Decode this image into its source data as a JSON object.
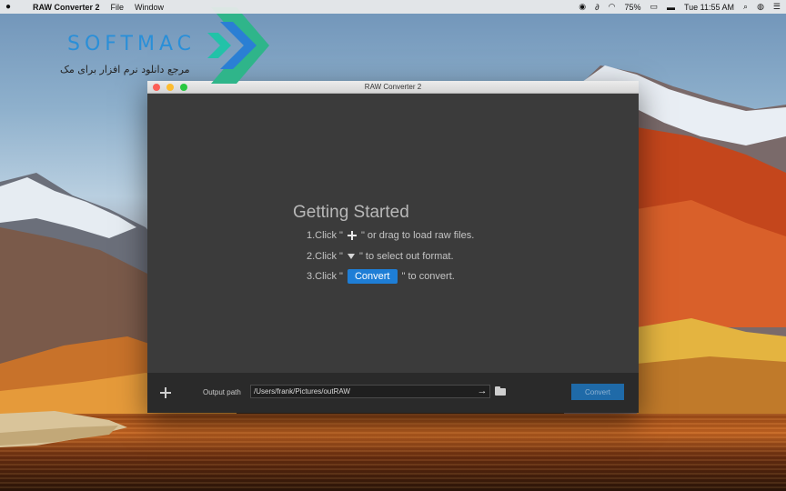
{
  "menubar": {
    "apple_icon": "apple-icon",
    "app_name": "RAW Converter 2",
    "menus": [
      "File",
      "Window"
    ],
    "battery": "75%",
    "clock": "Tue 11:55 AM"
  },
  "watermark": {
    "brand": "SOFTMAC",
    "tagline": "مرجع دانلود نرم افزار برای مک"
  },
  "window": {
    "title": "RAW Converter 2",
    "getting_started": {
      "title": "Getting Started",
      "step1_prefix": "1.Click \"",
      "step1_suffix": "\" or drag to load raw files.",
      "step2_prefix": "2.Click \"",
      "step2_suffix": "\" to select out format.",
      "step3_prefix": "3.Click \"",
      "step3_button": "Convert",
      "step3_suffix": "\" to convert."
    },
    "bottom": {
      "output_label": "Output path",
      "output_path": "/Users/frank/Pictures/outRAW",
      "convert_label": "Convert"
    }
  },
  "colors": {
    "accent": "#1e7ed6",
    "window_bg": "#3b3b3b",
    "bottombar_bg": "#2a2a2a"
  }
}
